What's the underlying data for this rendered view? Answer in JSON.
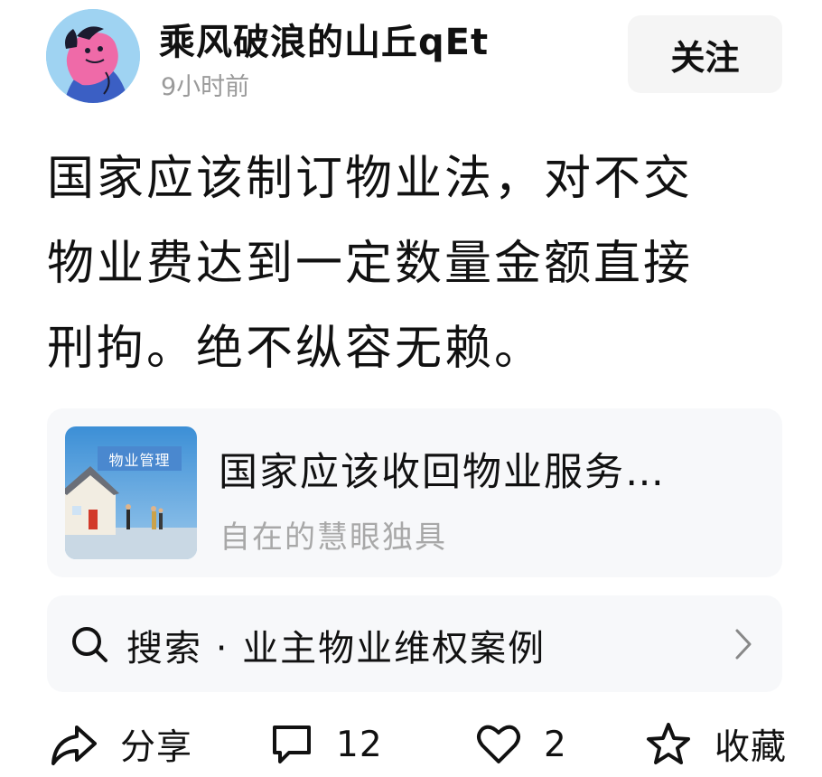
{
  "author": {
    "name": "乘风破浪的山丘qEt",
    "time": "9小时前",
    "follow_label": "关注"
  },
  "post": {
    "lines": [
      "国家应该制订物业法，对不交",
      "物业费达到一定数量金额直接",
      "刑拘。绝不纵容无赖。"
    ]
  },
  "link_card": {
    "thumb_label": "物业管理",
    "title": "国家应该收回物业服务…",
    "source": "自在的慧眼独具"
  },
  "search": {
    "text": "搜索 · 业主物业维权案例",
    "icon": "search-icon"
  },
  "actions": {
    "share_label": "分享",
    "comment_count": "12",
    "like_count": "2",
    "collect_label": "收藏"
  },
  "colors": {
    "avatar_bg": "#9fd3f2",
    "follow_bg": "#f5f5f5",
    "card_bg": "#f7f8fa",
    "muted_text": "#9a9a9a"
  }
}
